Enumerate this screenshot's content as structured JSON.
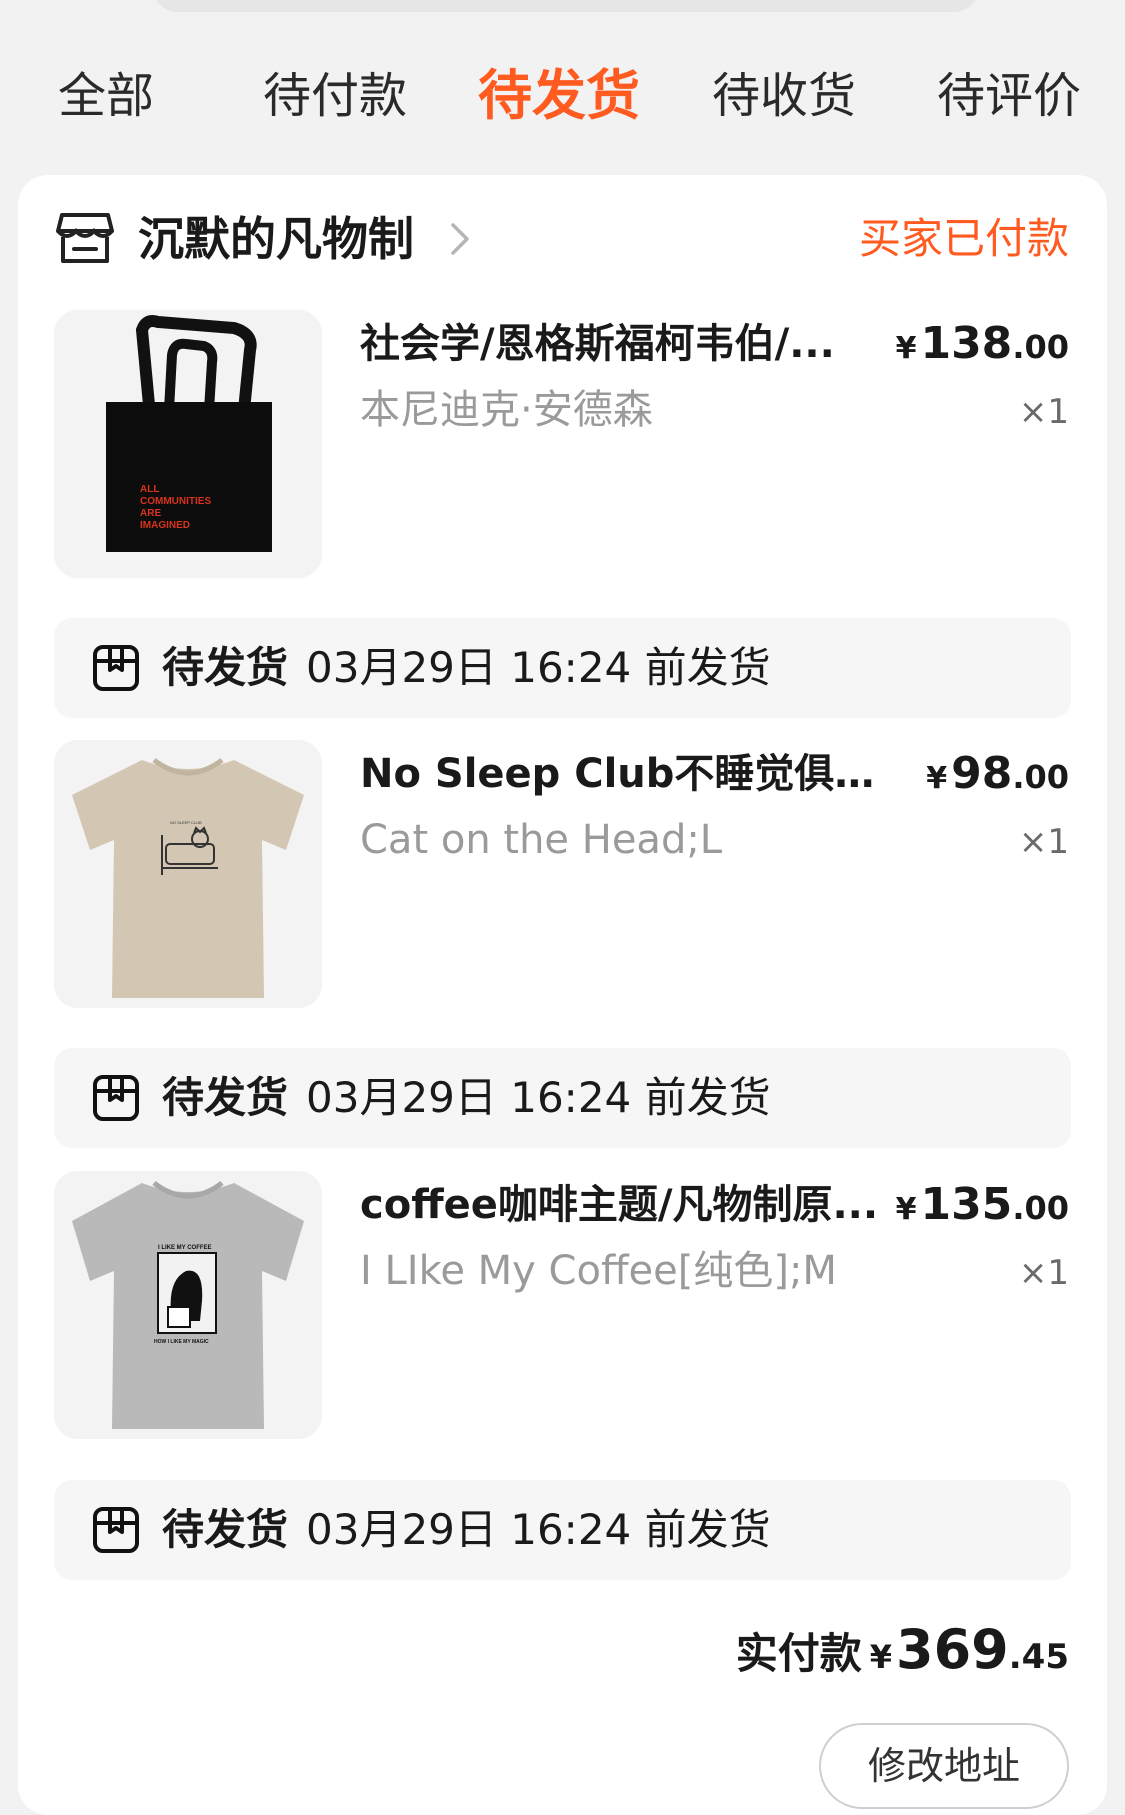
{
  "tabs": [
    {
      "label": "全部"
    },
    {
      "label": "待付款"
    },
    {
      "label": "待发货"
    },
    {
      "label": "待收货"
    },
    {
      "label": "待评价"
    }
  ],
  "order": {
    "shop_name": "沉默的凡物制",
    "status": "买家已付款",
    "accent_color": "#ff5a1f",
    "items": [
      {
        "title": "社会学/恩格斯福柯韦伯/...",
        "variant": "本尼迪克·安德森",
        "price_currency": "¥",
        "price_int": "138",
        "price_dec": ".00",
        "qty": "×1",
        "image_icon": "tote-bag-image",
        "image_text": [
          "ALL",
          "COMMUNITIES",
          "ARE",
          "IMAGINED"
        ],
        "ship_label": "待发货",
        "ship_time": "03月29日 16:24 前发货"
      },
      {
        "title": "No Sleep Club不睡觉俱乐...",
        "variant": "Cat on the Head;L",
        "price_currency": "¥",
        "price_int": "98",
        "price_dec": ".00",
        "qty": "×1",
        "image_icon": "beige-tshirt-image",
        "image_text": [
          "NO SLEEP CLUB"
        ],
        "ship_label": "待发货",
        "ship_time": "03月29日 16:24 前发货"
      },
      {
        "title": "coffee咖啡主题/凡物制原...",
        "variant": "I LIke My Coffee[纯色];M",
        "price_currency": "¥",
        "price_int": "135",
        "price_dec": ".00",
        "qty": "×1",
        "image_icon": "grey-tshirt-image",
        "image_text": [
          "I LIKE MY COFFEE",
          "HOW I LIKE MY MAGIC"
        ],
        "ship_label": "待发货",
        "ship_time": "03月29日 16:24 前发货"
      }
    ],
    "total_label": "实付款",
    "total_currency": "¥",
    "total_int": "369",
    "total_dec": ".45",
    "action_label": "修改地址"
  }
}
